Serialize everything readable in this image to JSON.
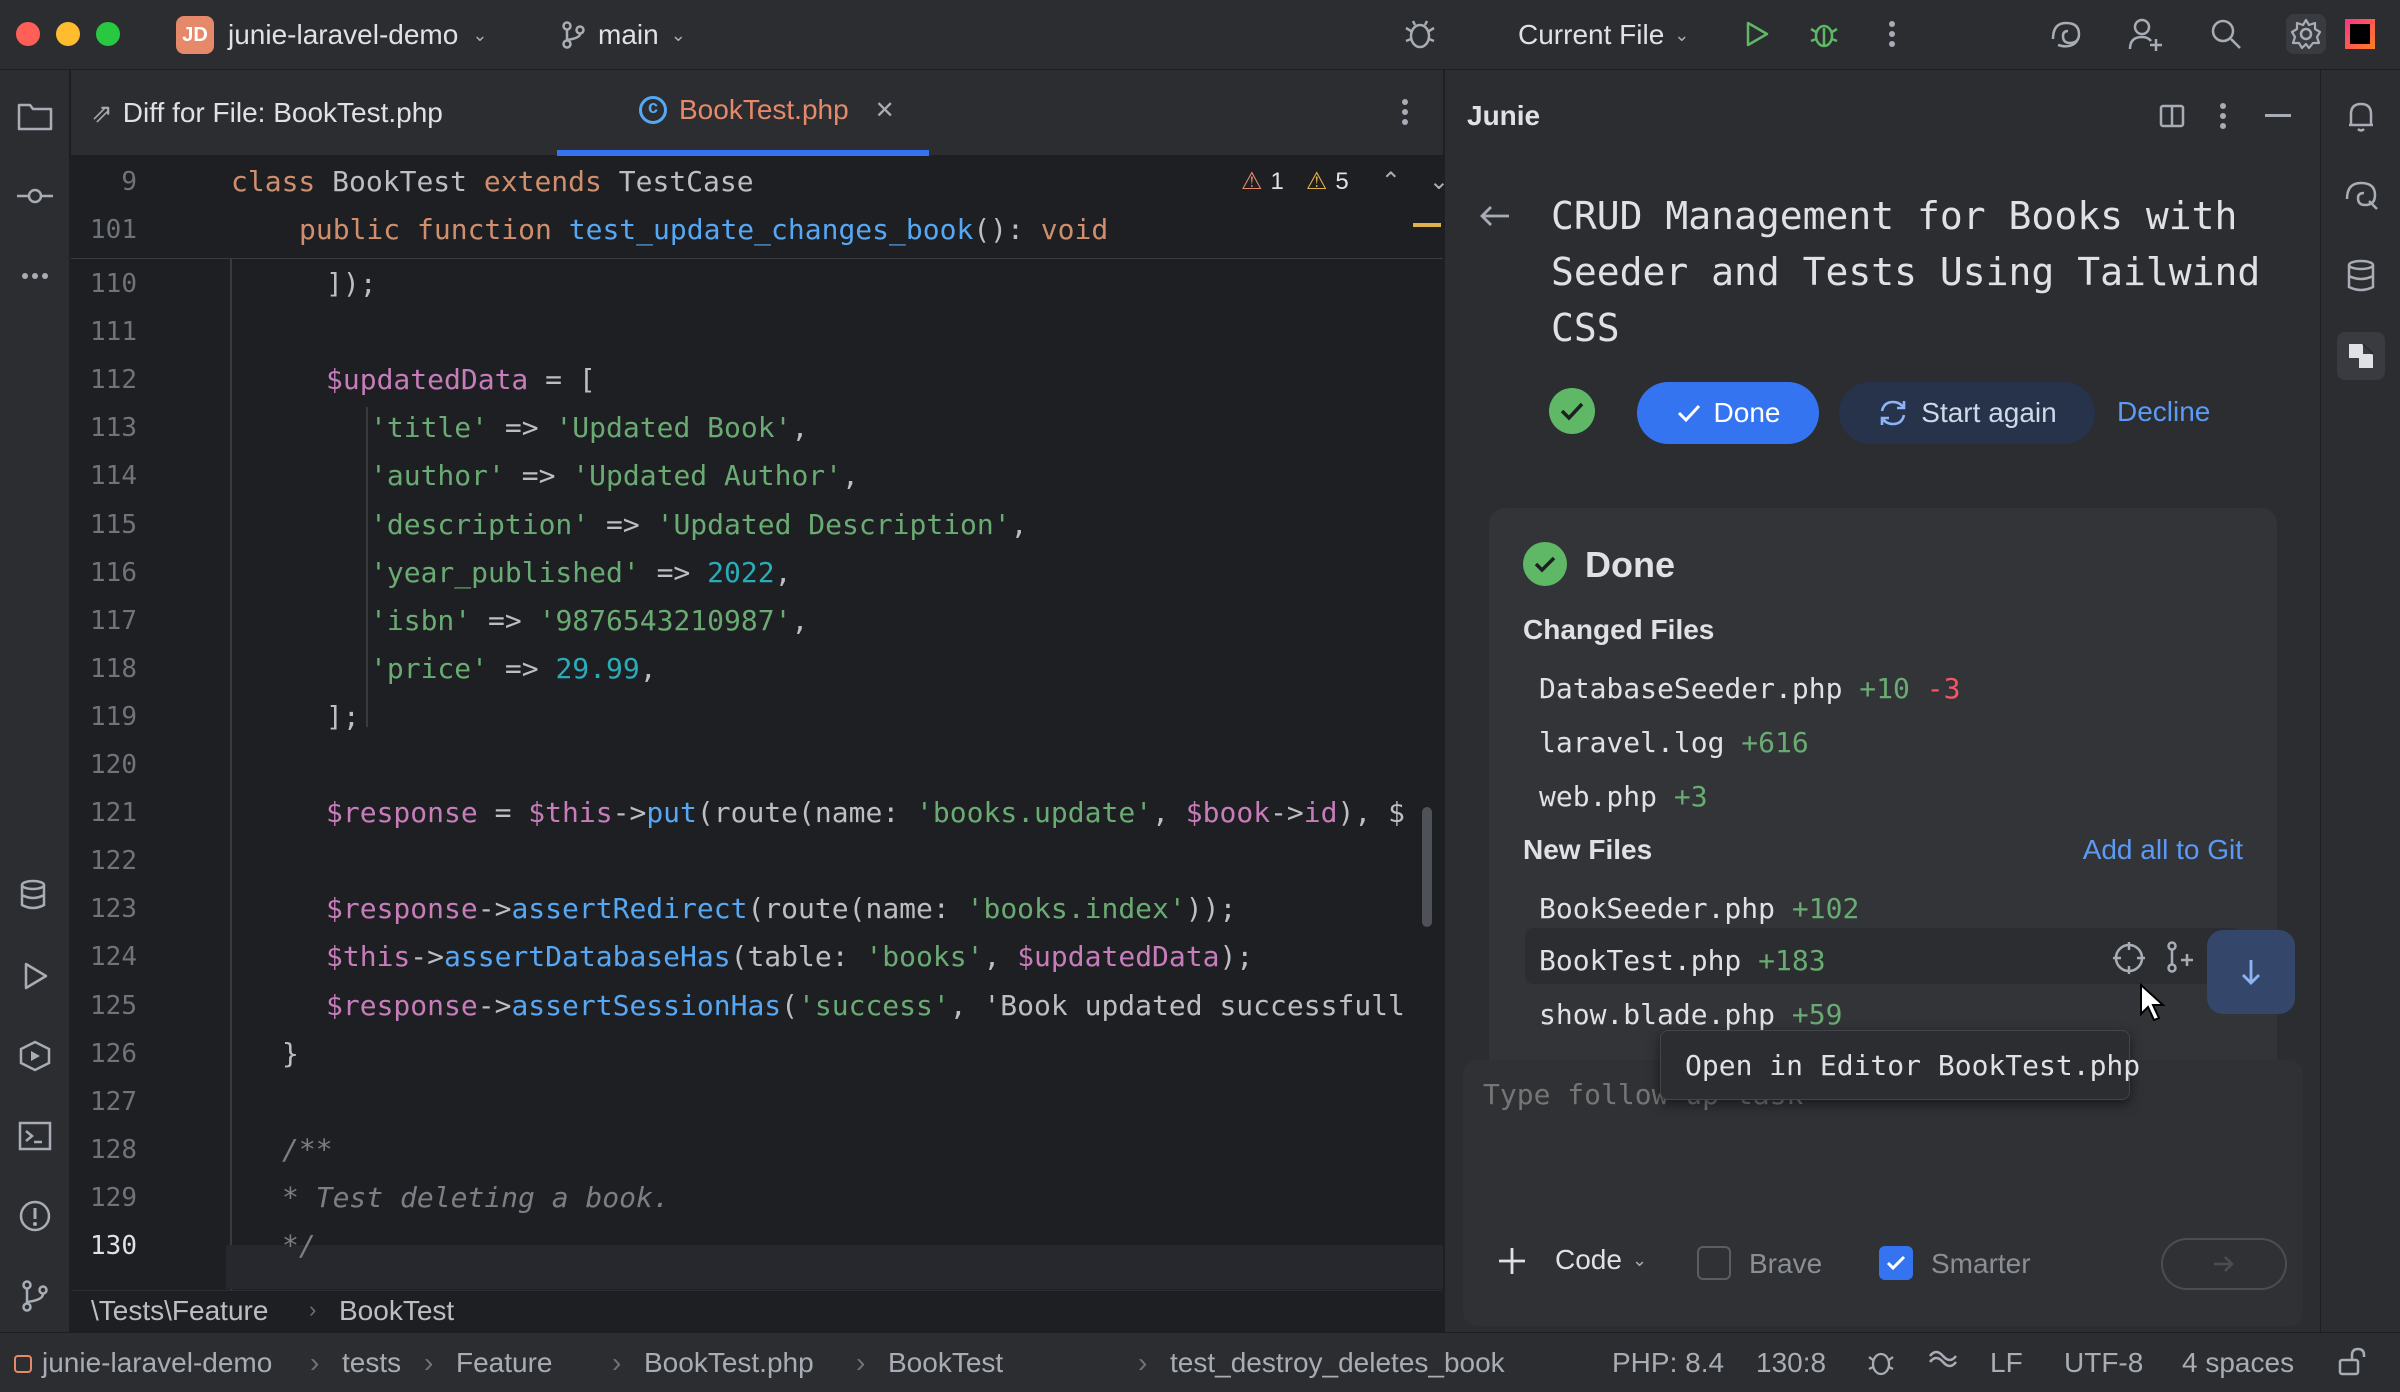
{
  "titlebar": {
    "project_badge": "JD",
    "project_name": "junie-laravel-demo",
    "branch": "main",
    "run_config": "Current File"
  },
  "editor": {
    "tabs": [
      {
        "label": "Diff for File: BookTest.php",
        "active": false
      },
      {
        "label": "BookTest.php",
        "active": true
      }
    ],
    "inspections": {
      "errors": "1",
      "warnings": "5"
    },
    "sticky_lines": [
      {
        "number": "9",
        "text": "class BookTest extends TestCase"
      },
      {
        "number": "101",
        "text": "public function test_update_changes_book(): void"
      }
    ],
    "lines": [
      {
        "number": "110",
        "text": "]);"
      },
      {
        "number": "111",
        "text": ""
      },
      {
        "number": "112",
        "text": "$updatedData = ["
      },
      {
        "number": "113",
        "text": "'title' => 'Updated Book',"
      },
      {
        "number": "114",
        "text": "'author' => 'Updated Author',"
      },
      {
        "number": "115",
        "text": "'description' => 'Updated Description',"
      },
      {
        "number": "116",
        "text": "'year_published' => 2022,"
      },
      {
        "number": "117",
        "text": "'isbn' => '9876543210987',"
      },
      {
        "number": "118",
        "text": "'price' => 29.99,"
      },
      {
        "number": "119",
        "text": "];"
      },
      {
        "number": "120",
        "text": ""
      },
      {
        "number": "121",
        "text": "$response = $this->put(route(name: 'books.update', $book->id), $"
      },
      {
        "number": "122",
        "text": ""
      },
      {
        "number": "123",
        "text": "$response->assertRedirect(route(name: 'books.index'));"
      },
      {
        "number": "124",
        "text": "$this->assertDatabaseHas(table: 'books', $updatedData);"
      },
      {
        "number": "125",
        "text": "$response->assertSessionHas('success', 'Book updated successfull"
      },
      {
        "number": "126",
        "text": "}"
      },
      {
        "number": "127",
        "text": ""
      },
      {
        "number": "128",
        "text": "/**"
      },
      {
        "number": "129",
        "text": "* Test deleting a book."
      },
      {
        "number": "130",
        "text": "*/"
      }
    ],
    "param_hints": {
      "name": "name:",
      "table": "table:"
    },
    "breadcrumb": {
      "namespace": "\\Tests\\Feature",
      "class": "BookTest"
    }
  },
  "junie": {
    "panel_title": "Junie",
    "task_title": "CRUD Management for Books with Seeder and Tests Using Tailwind CSS",
    "done_button": "Done",
    "start_again_button": "Start again",
    "decline_link": "Decline",
    "card": {
      "status": "Done",
      "changed_files_label": "Changed Files",
      "changed_files": [
        {
          "name": "DatabaseSeeder.php",
          "added": "+10",
          "removed": "-3"
        },
        {
          "name": "laravel.log",
          "added": "+616",
          "removed": ""
        },
        {
          "name": "web.php",
          "added": "+3",
          "removed": ""
        }
      ],
      "new_files_label": "New Files",
      "add_all_to_git": "Add all to Git",
      "new_files": [
        {
          "name": "BookSeeder.php",
          "added": "+102"
        },
        {
          "name": "BookTest.php",
          "added": "+183"
        },
        {
          "name": "show.blade.php",
          "added": "+59"
        }
      ]
    },
    "tooltip": "Open in Editor BookTest.php",
    "input_placeholder": "Type follow up task",
    "mode_label": "Code",
    "brave_label": "Brave",
    "smarter_label": "Smarter",
    "brave_checked": false,
    "smarter_checked": true
  },
  "statusbar": {
    "path": [
      "junie-laravel-demo",
      "tests",
      "Feature",
      "BookTest.php",
      "BookTest",
      "test_destroy_deletes_book"
    ],
    "php_version": "PHP: 8.4",
    "cursor": "130:8",
    "line_ending": "LF",
    "encoding": "UTF-8",
    "indent": "4 spaces"
  },
  "colors": {
    "accent": "#3574f0",
    "success": "#5fb865",
    "added": "#6aab73",
    "removed": "#f75464"
  }
}
